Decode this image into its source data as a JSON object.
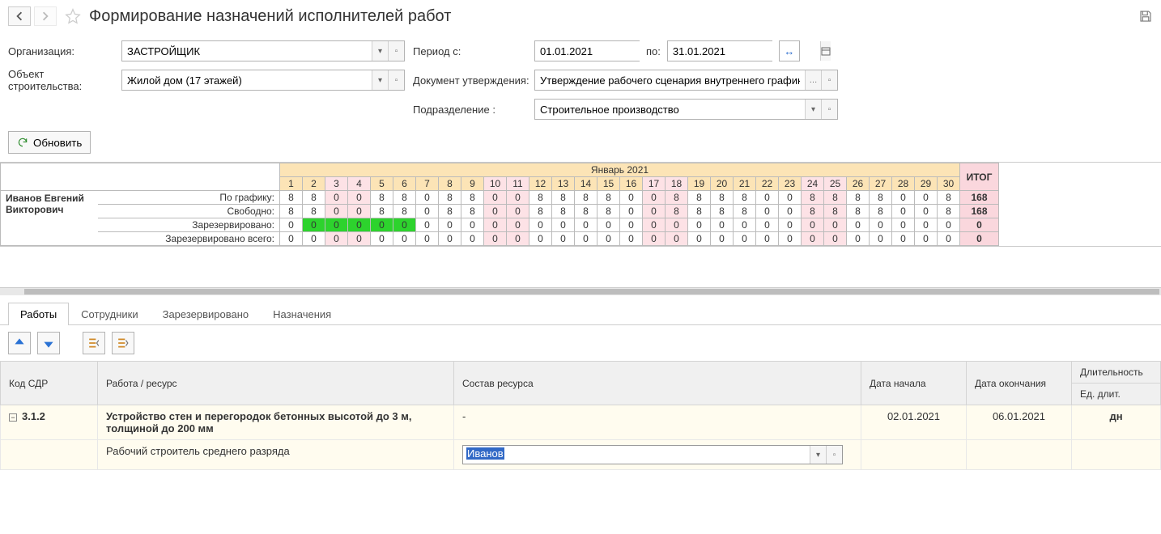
{
  "header": {
    "title": "Формирование назначений исполнителей работ"
  },
  "form": {
    "org_label": "Организация:",
    "org_value": "ЗАСТРОЙЩИК",
    "obj_label": "Объект строительства:",
    "obj_value": "Жилой дом (17 этажей)",
    "period_label": "Период с:",
    "period_from": "01.01.2021",
    "period_to_label": "по:",
    "period_to": "31.01.2021",
    "doc_label": "Документ утверждения:",
    "doc_value": "Утверждение рабочего сценария внутреннего графика работ...",
    "dept_label": "Подразделение :",
    "dept_value": "Строительное производство",
    "refresh": "Обновить"
  },
  "calendar": {
    "month": "Январь 2021",
    "total_label": "ИТОГ",
    "employee": "Иванов Евгений Викторович",
    "rows": [
      {
        "label": "По графику:",
        "vals": [
          8,
          8,
          0,
          0,
          8,
          8,
          0,
          8,
          8,
          0,
          0,
          8,
          8,
          8,
          8,
          0,
          0,
          8,
          8,
          8,
          8,
          0,
          0,
          8,
          8,
          8,
          8,
          0,
          0,
          8
        ],
        "total": 168
      },
      {
        "label": "Свободно:",
        "vals": [
          8,
          8,
          0,
          0,
          8,
          8,
          0,
          8,
          8,
          0,
          0,
          8,
          8,
          8,
          8,
          0,
          0,
          8,
          8,
          8,
          8,
          0,
          0,
          8,
          8,
          8,
          8,
          0,
          0,
          8
        ],
        "total": 168
      },
      {
        "label": "Зарезервировано:",
        "vals": [
          0,
          0,
          0,
          0,
          0,
          0,
          0,
          0,
          0,
          0,
          0,
          0,
          0,
          0,
          0,
          0,
          0,
          0,
          0,
          0,
          0,
          0,
          0,
          0,
          0,
          0,
          0,
          0,
          0,
          0
        ],
        "total": 0,
        "green": [
          2,
          3,
          4,
          5,
          6
        ]
      },
      {
        "label": "Зарезервировано всего:",
        "vals": [
          0,
          0,
          0,
          0,
          0,
          0,
          0,
          0,
          0,
          0,
          0,
          0,
          0,
          0,
          0,
          0,
          0,
          0,
          0,
          0,
          0,
          0,
          0,
          0,
          0,
          0,
          0,
          0,
          0,
          0
        ],
        "total": 0
      }
    ],
    "weekends": [
      3,
      4,
      10,
      11,
      17,
      18,
      24,
      25
    ]
  },
  "tabs": {
    "t1": "Работы",
    "t2": "Сотрудники",
    "t3": "Зарезервировано",
    "t4": "Назначения"
  },
  "grid": {
    "cols": {
      "c1": "Код СДР",
      "c2": "Работа / ресурс",
      "c3": "Состав ресурса",
      "c4": "Дата начала",
      "c5": "Дата окончания",
      "c6": "Длительность",
      "c6b": "Ед. длит."
    },
    "group": {
      "code": "3.1.2",
      "name": "Устройство стен и перегородок бетонных высотой до 3 м, толщиной до 200 мм",
      "dash": "-",
      "start": "02.01.2021",
      "end": "06.01.2021",
      "unit": "дн"
    },
    "row": {
      "name": "Рабочий строитель среднего разряда",
      "input": "Иванов"
    }
  }
}
